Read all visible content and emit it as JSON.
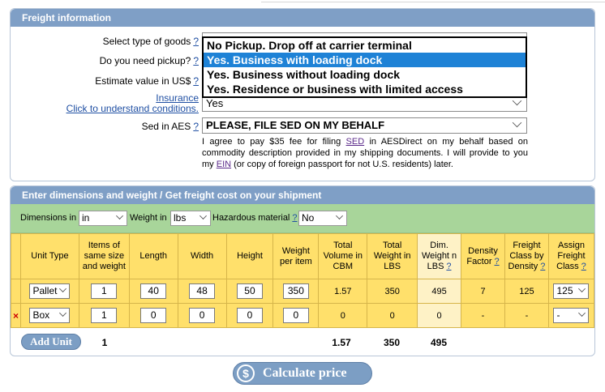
{
  "freight": {
    "header": "Freight information",
    "labels": {
      "goods_type": "Select type of goods",
      "pickup": "Do you need pickup?",
      "estimate": "Estimate value in US$",
      "insurance": "Insurance",
      "insurance_link": "Click to understand conditions.",
      "sed": "Sed in AES"
    },
    "help": "?",
    "pickup_options": [
      "No Pickup. Drop off at carrier terminal",
      "Yes. Business with loading dock",
      "Yes. Business without loading dock",
      "Yes. Residence or business with limited access"
    ],
    "insurance_value": "Yes",
    "sed_value": "PLEASE, FILE SED ON MY BEHALF",
    "agreement": {
      "part1": "I agree to pay $35 fee for filing ",
      "sed_link": "SED",
      "part2": " in AESDirect on my behalf based on commodity description provided in my shipping documents. I will provide to you my ",
      "ein_link": "EIN",
      "part3": " (or copy of foreign passport for not U.S. residents) later."
    }
  },
  "dimensions": {
    "header": "Enter dimensions and weight / Get freight cost on your shipment",
    "dim_label": "Dimensions in",
    "dim_value": "in",
    "weight_label": "Weight in",
    "weight_value": "lbs",
    "hazard_label": "Hazardous material",
    "hazard_value": "No",
    "columns": [
      "Unit Type",
      "Items of same size and weight",
      "Length",
      "Width",
      "Height",
      "Weight per item",
      "Total Volume in CBM",
      "Total Weight in LBS",
      "Dim. Weight n LBS",
      "Density Factor",
      "Freight Class by Density",
      "Assign Freight Class"
    ],
    "rows": [
      {
        "remove": "",
        "type": "Pallet",
        "items": "1",
        "length": "40",
        "width": "48",
        "height": "50",
        "weight": "350",
        "volume": "1.57",
        "total_weight": "350",
        "dim_weight": "495",
        "density": "7",
        "class_density": "125",
        "assign": "125"
      },
      {
        "remove": "×",
        "type": "Box",
        "items": "1",
        "length": "0",
        "width": "0",
        "height": "0",
        "weight": "0",
        "volume": "0",
        "total_weight": "0",
        "dim_weight": "0",
        "density": "-",
        "class_density": "-",
        "assign": "-"
      }
    ],
    "add_unit": "Add Unit",
    "totals": {
      "items": "1",
      "volume": "1.57",
      "weight": "350",
      "dim_weight": "495"
    }
  },
  "calculate": "Calculate price",
  "calc_icon": "$"
}
